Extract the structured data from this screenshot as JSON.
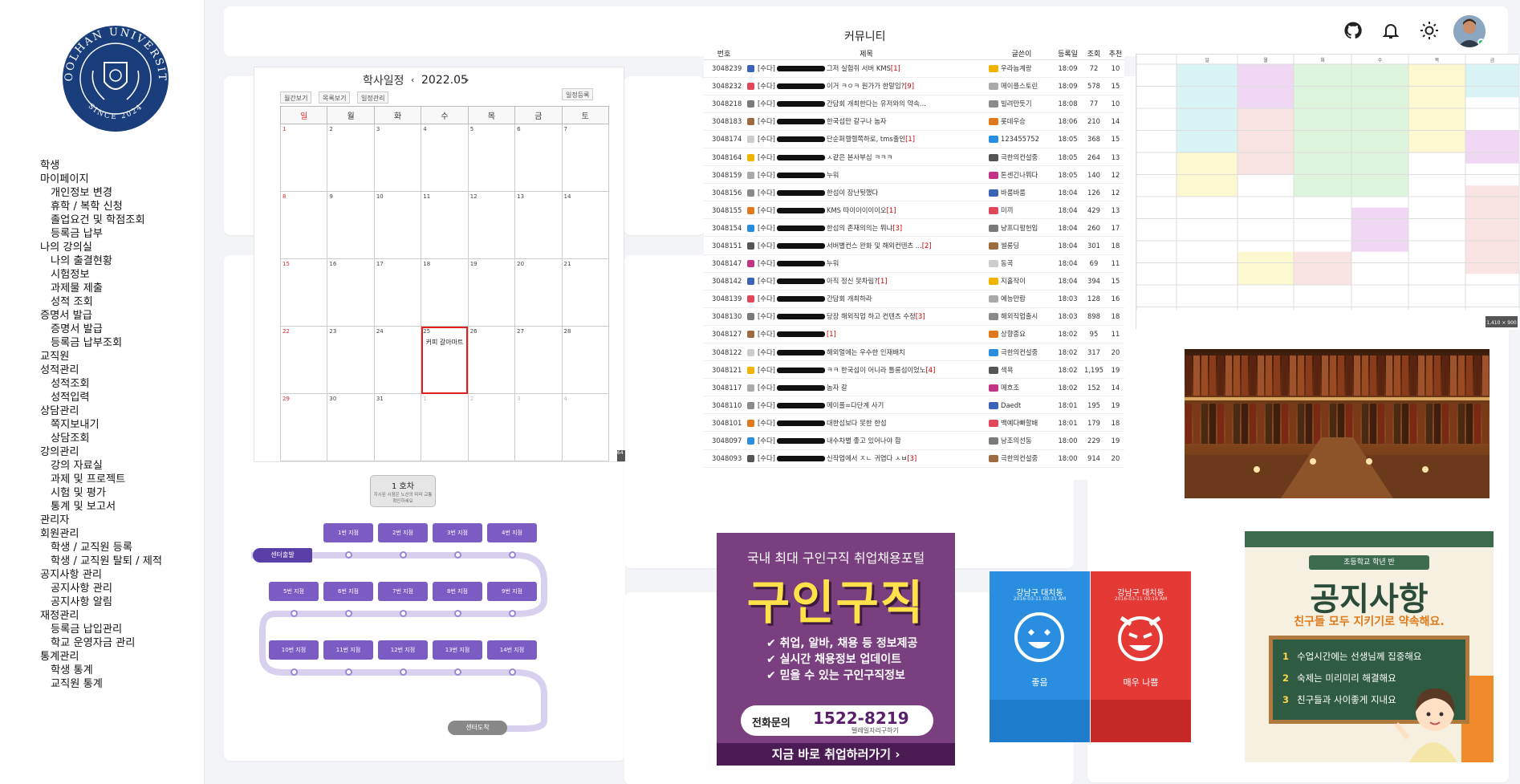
{
  "sidebar": {
    "logo_top": "KOOLHAN UNIVERSITY",
    "logo_bottom": "SINCE 2024",
    "groups": [
      {
        "label": "학생",
        "items": []
      },
      {
        "label": "마이페이지",
        "items": [
          "개인정보 변경",
          "휴학 / 복학 신청",
          "졸업요건 및 학점조회",
          "등록금 납부"
        ]
      },
      {
        "label": "나의 강의실",
        "items": [
          "나의 출결현황",
          "시험정보",
          "과제물 제출",
          "성적 조회"
        ]
      },
      {
        "label": "증명서 발급",
        "items": [
          "증명서 발급",
          "등록금 납부조회"
        ]
      },
      {
        "label": "교직원",
        "items": []
      },
      {
        "label": "성적관리",
        "items": [
          "성적조회",
          "성적입력"
        ]
      },
      {
        "label": "상담관리",
        "items": [
          "쪽지보내기",
          "상담조회"
        ]
      },
      {
        "label": "강의관리",
        "items": [
          "강의 자료실",
          "과제 및 프로젝트",
          "시험 및 평가",
          "통계 및 보고서"
        ]
      },
      {
        "label": "관리자",
        "items": []
      },
      {
        "label": "회원관리",
        "items": [
          "학생 / 교직원 등록",
          "학생 / 교직원 탈퇴 / 제적"
        ]
      },
      {
        "label": "공지사항 관리",
        "items": [
          "공지사항 관리",
          "공지사항 알림"
        ]
      },
      {
        "label": "재정관리",
        "items": [
          "등록금 납입관리",
          "학교 운영자금 관리"
        ]
      },
      {
        "label": "통계관리",
        "items": [
          "학생 통계",
          "교직원 통계"
        ]
      }
    ]
  },
  "topbar": {
    "icons": [
      "github-icon",
      "bell-icon",
      "sun-icon",
      "avatar"
    ]
  },
  "calendar": {
    "title": "학사일정",
    "month": "2022.05",
    "tabs": [
      "월간보기",
      "목록보기",
      "일정관리"
    ],
    "add_btn": "일정등록",
    "weekdays": [
      "일",
      "월",
      "화",
      "수",
      "목",
      "금",
      "토"
    ],
    "weeks": [
      [
        "1",
        "2",
        "3",
        "4",
        "5",
        "6",
        "7"
      ],
      [
        "8",
        "9",
        "10",
        "11",
        "12",
        "13",
        "14"
      ],
      [
        "15",
        "16",
        "17",
        "18",
        "19",
        "20",
        "21"
      ],
      [
        "22",
        "23",
        "24",
        "25",
        "26",
        "27",
        "28"
      ],
      [
        "29",
        "30",
        "31",
        "1",
        "2",
        "3",
        "4"
      ]
    ],
    "event": {
      "day": "25",
      "text": "커피 갈아마트"
    },
    "corner": "64"
  },
  "community": {
    "title": "커뮤니티",
    "headers": [
      "번호",
      "제목",
      "글쓴이",
      "등록일",
      "조회",
      "추천"
    ],
    "rows": [
      [
        "3048239",
        "[수다]",
        "그저 실험쥐 서버 KMS",
        "[1]",
        "우라늄계랑",
        "18:09",
        "72",
        "10"
      ],
      [
        "3048232",
        "[수다]",
        "이거 ㅋㅇㅋ 원가가 한말임?",
        "[9]",
        "메이플스토린",
        "18:09",
        "578",
        "15"
      ],
      [
        "3048218",
        "[수다]",
        "간담회 개최한다는 유저와의 약속...",
        "",
        "빌려만듯기",
        "18:08",
        "77",
        "10"
      ],
      [
        "3048183",
        "[수다]",
        "한국섭만   갈구나 놈자",
        "",
        "롯데우승",
        "18:06",
        "210",
        "14"
      ],
      [
        "3048174",
        "[수다]",
        "단순퍼렐렐쪽하로, tms출인",
        "[1]",
        "123455752",
        "18:05",
        "368",
        "15"
      ],
      [
        "3048164",
        "[수다]",
        "ㅅ같은 본사부심 ㅋㅋㅋ",
        "",
        "극한의컨설중",
        "18:05",
        "264",
        "13"
      ],
      [
        "3048159",
        "[수다]",
        "누워",
        "",
        "톤센긴나뭐다",
        "18:05",
        "140",
        "12"
      ],
      [
        "3048156",
        "[수다]",
        "한섭이 장난뒷했다",
        "",
        "바룸바룸",
        "18:04",
        "126",
        "12"
      ],
      [
        "3048155",
        "[수다]",
        "KMS 따이이이이이오",
        "[1]",
        "미끼",
        "18:04",
        "429",
        "13"
      ],
      [
        "3048154",
        "[수다]",
        "한섭의 존재의의는 뭐냐",
        "[3]",
        "냥프디펄헌입",
        "18:04",
        "260",
        "17"
      ],
      [
        "3048151",
        "[수다]",
        "서버별컨스 완화 및 해외컨텐츠 ...",
        "[2]",
        "썰롱딩",
        "18:04",
        "301",
        "18"
      ],
      [
        "3048147",
        "[수다]",
        "누워",
        "",
        "동곡",
        "18:04",
        "69",
        "11"
      ],
      [
        "3048142",
        "[수다]",
        "아직 정신 못차림?",
        "[1]",
        "지홀작이",
        "18:04",
        "394",
        "15"
      ],
      [
        "3048139",
        "[수다]",
        "간담회 개최하라",
        "",
        "예능만랍",
        "18:03",
        "128",
        "16"
      ],
      [
        "3048130",
        "[수다]",
        "당장 해외직업 하고 컨텐츠 수정",
        "[3]",
        "해외직업출시",
        "18:03",
        "898",
        "18"
      ],
      [
        "3048127",
        "[수다]",
        "",
        "[1]",
        "상향종요",
        "18:02",
        "95",
        "11"
      ],
      [
        "3048122",
        "[수다]",
        "해외얼에는 우수한 인재배치",
        "",
        "극한의컨설중",
        "18:02",
        "317",
        "20"
      ],
      [
        "3048121",
        "[수다]",
        "ㅋㅋ 한국섭이 어니라 틀롱섭이었노",
        "[4]",
        "색욕",
        "18:02",
        "1,195",
        "19"
      ],
      [
        "3048117",
        "[수다]",
        "놈자 갈",
        "",
        "메흐조",
        "18:02",
        "152",
        "14"
      ],
      [
        "3048110",
        "[수다]",
        "메이플=다단계 사기",
        "",
        "Daedt",
        "18:01",
        "195",
        "19"
      ],
      [
        "3048101",
        "[수다]",
        "대한섬보다 못한 한섭",
        "",
        "백예다빠할배",
        "18:01",
        "179",
        "18"
      ],
      [
        "3048097",
        "[수다]",
        "내수차별 좋고 있어나야 함",
        "",
        "낭조의선동",
        "18:00",
        "229",
        "19"
      ],
      [
        "3048093",
        "[수다]",
        "신작업에서 ㅈㄴ 귀엽다 ㅅㅂ",
        "[3]",
        "극한의컨설중",
        "18:00",
        "914",
        "20"
      ]
    ]
  },
  "timetable": {
    "days": [
      "",
      "일",
      "월",
      "화",
      "수",
      "목",
      "금"
    ],
    "corner": "1,410 × 900"
  },
  "roadmap": {
    "header_title": "1 호차",
    "header_sub": "지시된 시점은 노선의 따라 교통 확인하세요",
    "start": "센터출발",
    "end": "센터도착",
    "row1": [
      "1번 지점",
      "2번 지점",
      "3번 지점",
      "4번 지점"
    ],
    "row2": [
      "5번 지점",
      "6번 지점",
      "7번 지점",
      "8번 지점",
      "9번 지점"
    ],
    "row3": [
      "10번 지점",
      "11번 지점",
      "12번 지점",
      "13번 지점",
      "14번 지점"
    ]
  },
  "ad_job": {
    "line1": "국내 최대 구인구직 취업채용포털",
    "main": "구인구직",
    "bullets": [
      "취업, 알바, 채용 등 정보제공",
      "실시간 채용정보 업데이트",
      "믿을 수 있는 구인구직정보"
    ],
    "phone_label": "전화문의",
    "phone": "1522-8219",
    "phone_sub": "텔레일자리구하기",
    "cta": "지금 바로 취업하러가기  ›"
  },
  "weather": {
    "left": {
      "place": "강남구 대치동",
      "status": "좋음",
      "date": "2016-03-11 00:31 AM"
    },
    "right": {
      "place": "강남구 대치동",
      "status": "매우 나쁨",
      "date": "2016-03-11 00:16 AM"
    }
  },
  "notice": {
    "header": "초등학교   학년   반",
    "title": "공지사항",
    "subtitle": "친구들 모두 지키기로 약속해요.",
    "rules": [
      {
        "n": "1",
        "t": "수업시간에는 선생님께 집중해요"
      },
      {
        "n": "2",
        "t": "숙제는 미리미리 해결해요"
      },
      {
        "n": "3",
        "t": "친구들과 사이좋게 지내요"
      }
    ]
  },
  "colors": {
    "accent": "#7b5cc4",
    "red": "#d32f2f",
    "blue": "#1e88e5"
  }
}
